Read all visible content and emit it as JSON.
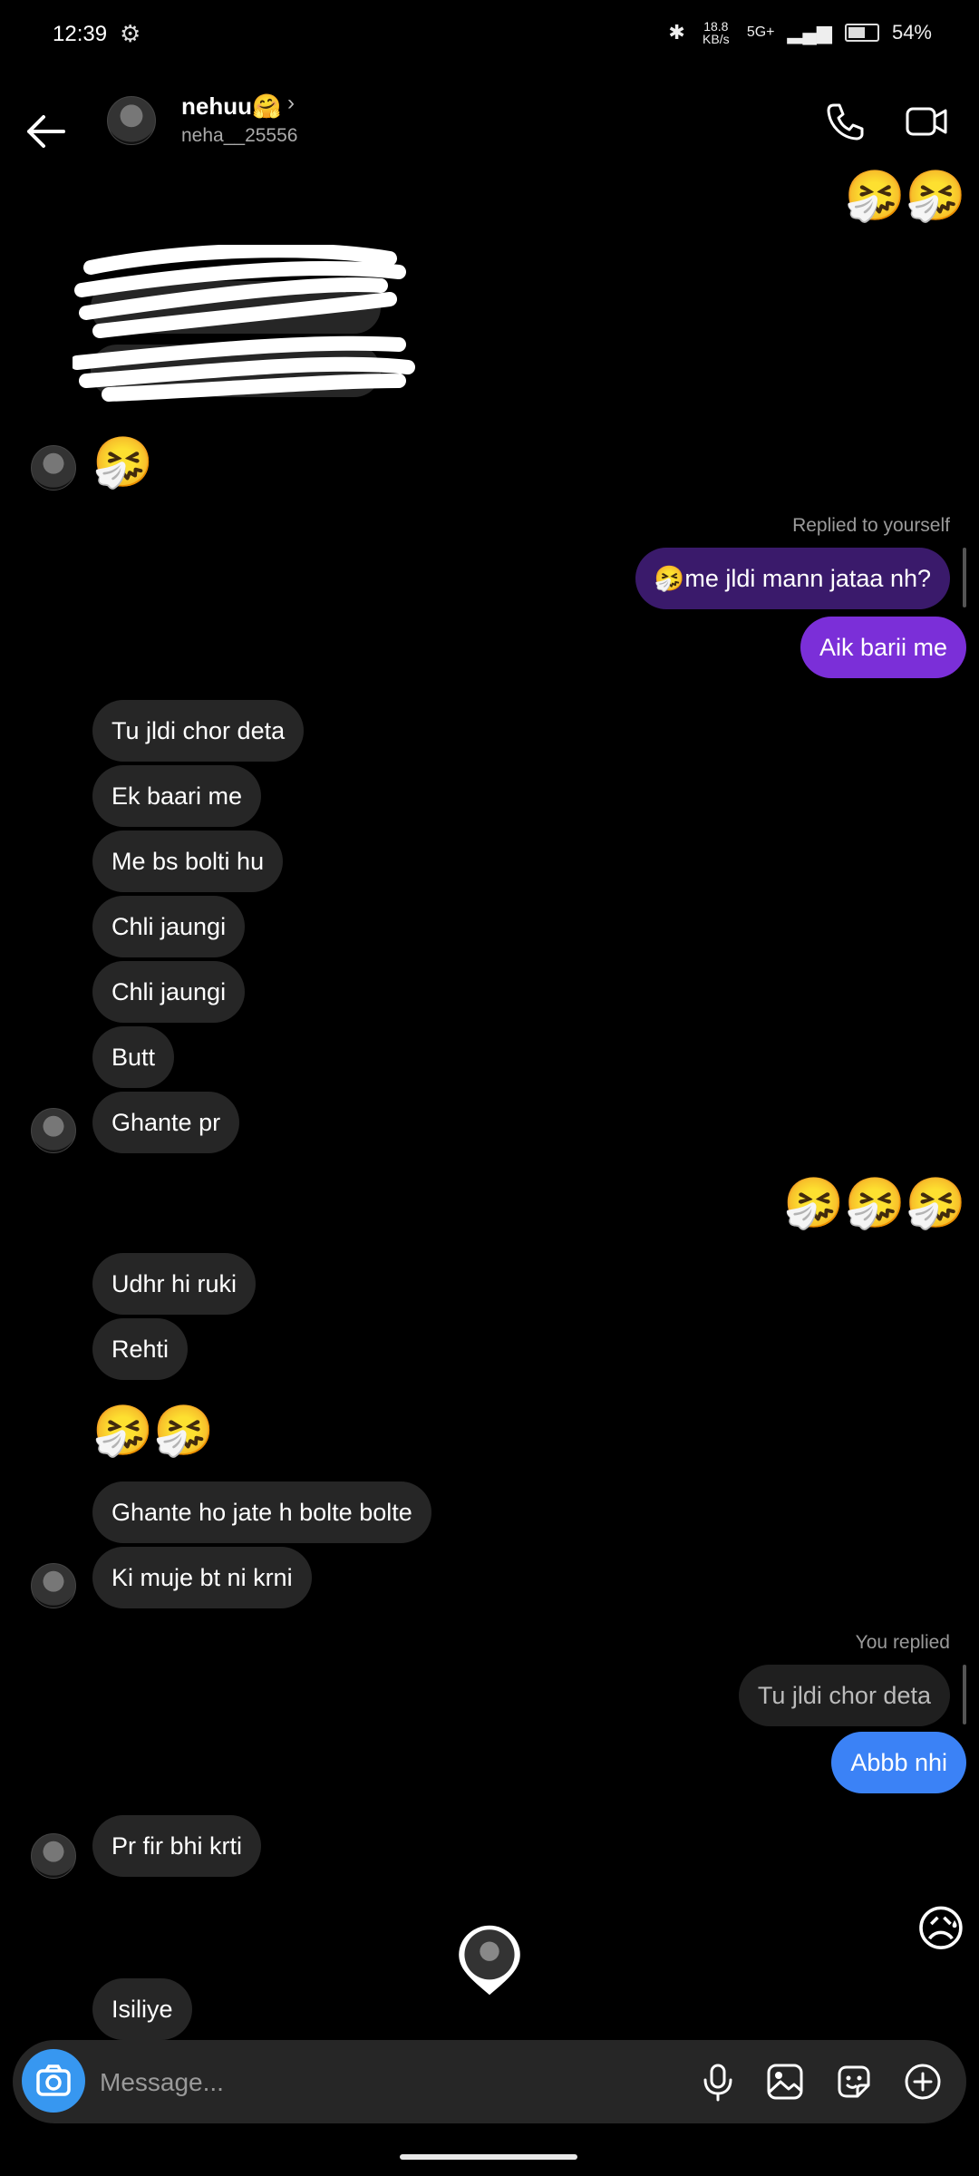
{
  "status_bar": {
    "time": "12:39",
    "network": "5G+",
    "speed": "18.8 KB/s",
    "battery": "54%",
    "battery_level": 0.54
  },
  "header": {
    "username": "nehuu🤗",
    "handle": "neha__25556",
    "icons": [
      "back-arrow-icon",
      "chevron-right-icon",
      "phone-icon",
      "video-camera-icon"
    ]
  },
  "messages": {
    "m1_emoji": "🤧🤧",
    "m2_emoji": "🤧",
    "reply1_meta": "Replied to yourself",
    "reply1_quote": "🤧me jldi mann jataa nh?",
    "reply1_text": "Aik barii me",
    "in1": "Tu jldi chor deta",
    "in2": "Ek baari me",
    "in3": "Me bs bolti hu",
    "in4": "Chli jaungi",
    "in5": "Chli jaungi",
    "in6": "Butt",
    "in7": "Ghante pr",
    "out_emoji": "🤧🤧🤧",
    "in8": "Udhr hi ruki",
    "in9": "Rehti",
    "in_emoji": "🤧🤧",
    "in10": "Ghante ho jate h bolte bolte",
    "in11": "Ki muje bt ni krni",
    "reply2_meta": "You replied",
    "reply2_quote": "Tu jldi chor deta",
    "reply2_text": "Abbb nhi",
    "in12": "Pr fir bhi krti",
    "out_sad": "😥",
    "in13": "Isiliye"
  },
  "composer": {
    "placeholder": "Message..."
  },
  "colors": {
    "background": "#000000",
    "incoming_bubble": "#262626",
    "outgoing_purple": "#7b2fd8",
    "outgoing_blue": "#3b82f6",
    "camera_button": "#3797f0"
  }
}
